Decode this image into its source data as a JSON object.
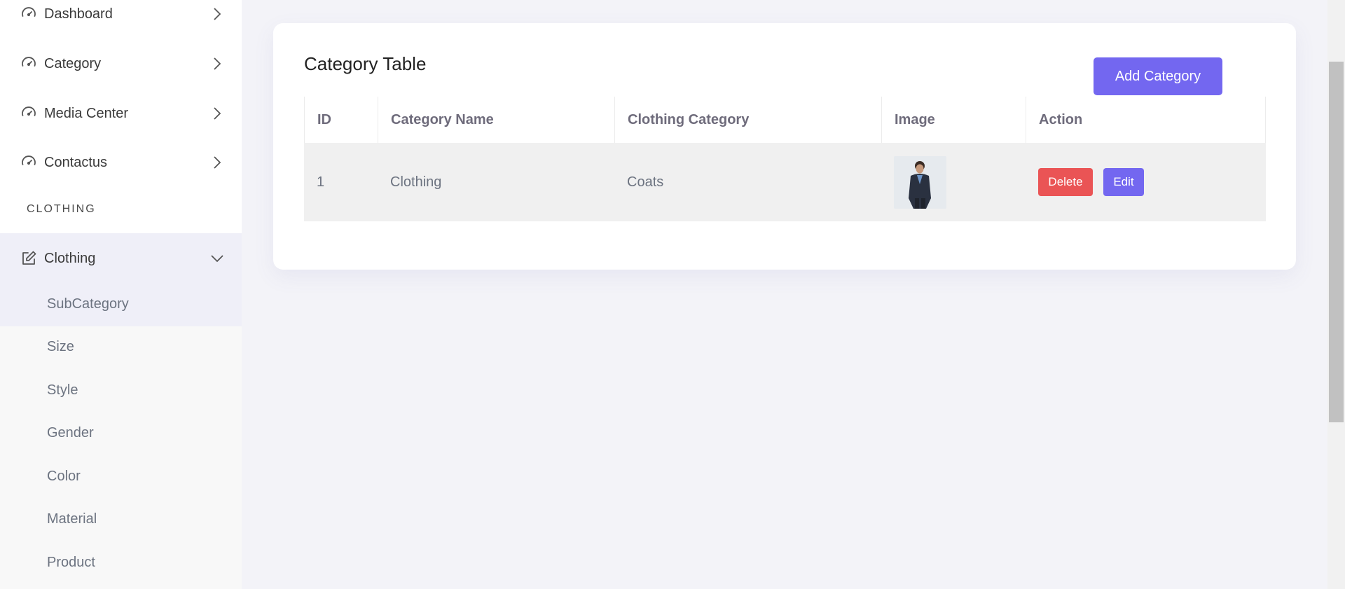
{
  "sidebar": {
    "items": [
      {
        "label": "Dashboard",
        "icon": "gauge-icon"
      },
      {
        "label": "Category",
        "icon": "gauge-icon"
      },
      {
        "label": "Media Center",
        "icon": "gauge-icon"
      },
      {
        "label": "Contactus",
        "icon": "gauge-icon"
      }
    ],
    "section_title": "CLOTHING",
    "clothing": {
      "label": "Clothing",
      "icon": "edit-icon"
    },
    "submenu": [
      "SubCategory",
      "Size",
      "Style",
      "Gender",
      "Color",
      "Material",
      "Product"
    ]
  },
  "card": {
    "title": "Category Table",
    "add_button": "Add Category"
  },
  "table": {
    "headers": [
      "ID",
      "Category Name",
      "Clothing Category",
      "Image",
      "Action"
    ],
    "rows": [
      {
        "id": "1",
        "category_name": "Clothing",
        "clothing_category": "Coats",
        "delete_label": "Delete",
        "edit_label": "Edit"
      }
    ]
  },
  "colors": {
    "accent": "#7367f0",
    "danger": "#ea5455",
    "background": "#f3f3f8"
  }
}
